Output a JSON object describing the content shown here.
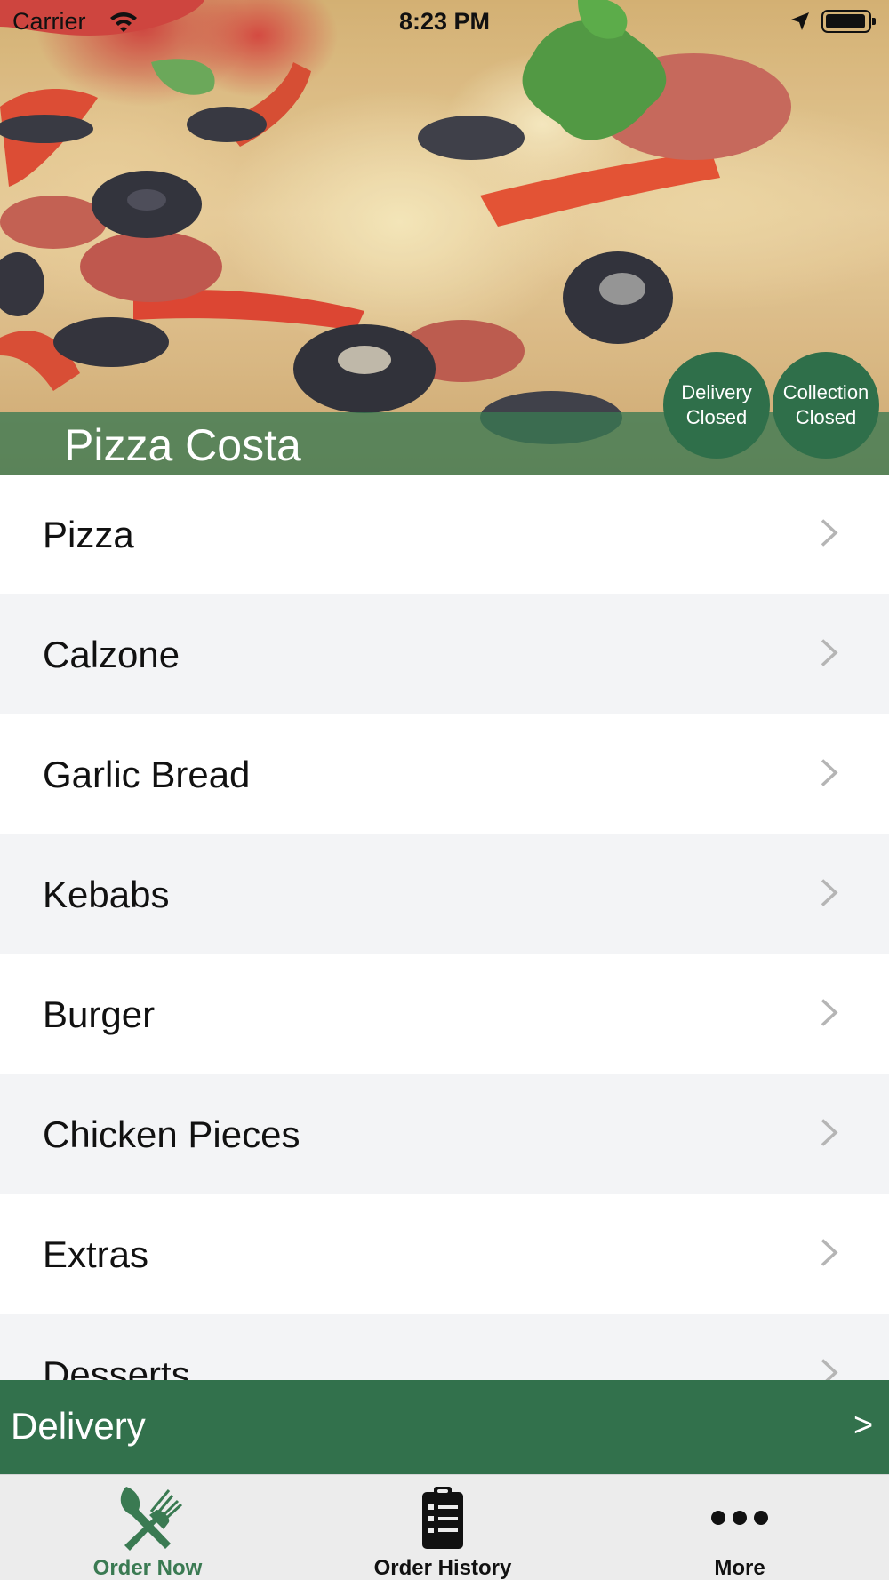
{
  "status_bar": {
    "carrier": "Carrier",
    "time": "8:23 PM"
  },
  "restaurant": {
    "name": "Pizza Costa",
    "delivery_status": [
      "Delivery",
      "Closed"
    ],
    "collection_status": [
      "Collection",
      "Closed"
    ]
  },
  "categories": [
    {
      "label": "Pizza"
    },
    {
      "label": "Calzone"
    },
    {
      "label": "Garlic Bread"
    },
    {
      "label": "Kebabs"
    },
    {
      "label": "Burger"
    },
    {
      "label": "Chicken Pieces"
    },
    {
      "label": "Extras"
    },
    {
      "label": "Desserts"
    }
  ],
  "order_mode": {
    "label": "Delivery",
    "arrow": ">"
  },
  "tabs": [
    {
      "label": "Order Now",
      "icon": "fork-knife-icon",
      "active": true
    },
    {
      "label": "Order History",
      "icon": "clipboard-list-icon",
      "active": false
    },
    {
      "label": "More",
      "icon": "more-dots-icon",
      "active": false
    }
  ],
  "colors": {
    "brand_green": "#32714c",
    "active_tab": "#3a7a52",
    "alt_row": "#f3f4f6"
  }
}
